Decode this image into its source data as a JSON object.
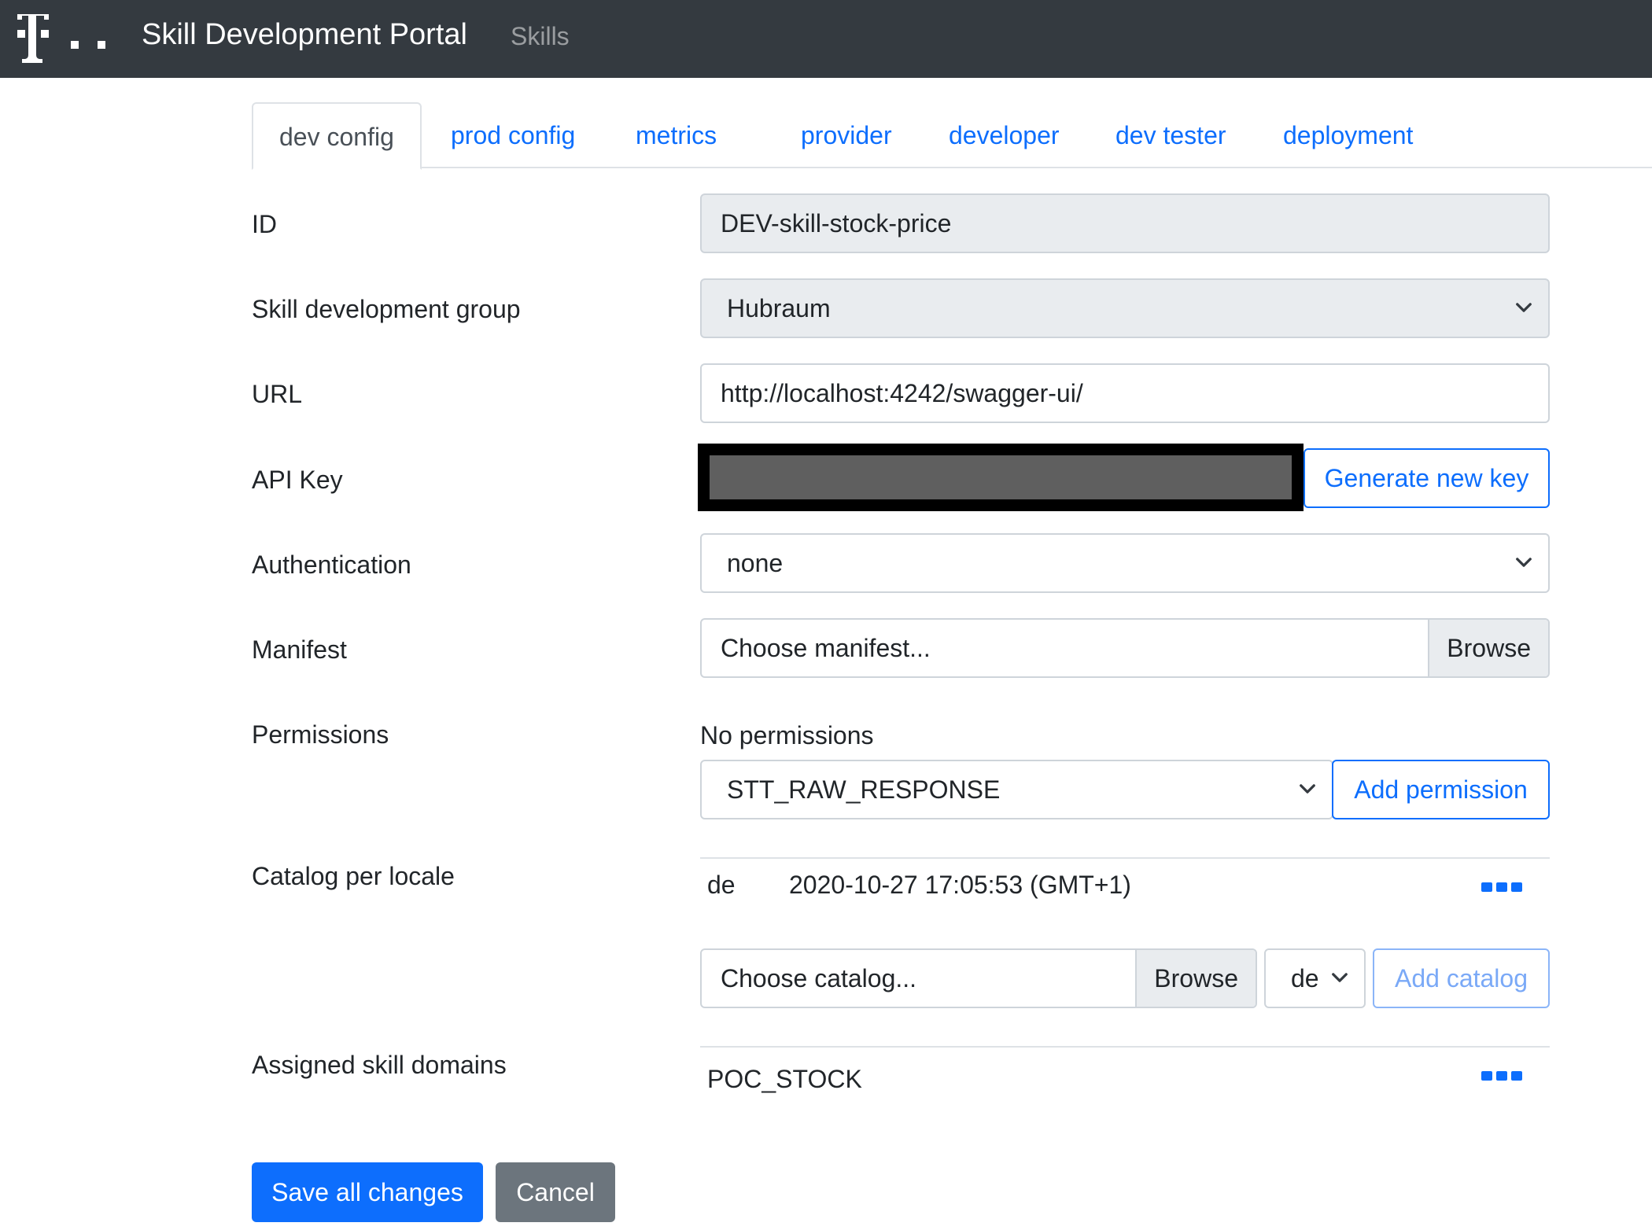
{
  "navbar": {
    "brand": "Skill Development Portal",
    "nav_link": "Skills",
    "logo_icon": "telekom-t-logo"
  },
  "tabs": [
    {
      "label": "dev config",
      "active": true
    },
    {
      "label": "prod config",
      "active": false
    },
    {
      "label": "metrics",
      "active": false
    },
    {
      "label": "provider",
      "active": false
    },
    {
      "label": "developer",
      "active": false
    },
    {
      "label": "dev tester",
      "active": false
    },
    {
      "label": "deployment",
      "active": false
    }
  ],
  "form": {
    "id": {
      "label": "ID",
      "value": "DEV-skill-stock-price"
    },
    "group": {
      "label": "Skill development group",
      "value": "Hubraum"
    },
    "url": {
      "label": "URL",
      "value": "http://localhost:4242/swagger-ui/"
    },
    "api_key": {
      "label": "API Key",
      "button": "Generate new key"
    },
    "authentication": {
      "label": "Authentication",
      "value": "none"
    },
    "manifest": {
      "label": "Manifest",
      "placeholder": "Choose manifest...",
      "browse": "Browse"
    },
    "permissions": {
      "label": "Permissions",
      "status": "No permissions",
      "selected": "STT_RAW_RESPONSE",
      "button": "Add permission"
    },
    "catalog": {
      "label": "Catalog per locale",
      "entries": [
        {
          "locale": "de",
          "timestamp": "2020-10-27 17:05:53 (GMT+1)"
        }
      ],
      "placeholder": "Choose catalog...",
      "browse": "Browse",
      "locale_selected": "de",
      "button": "Add catalog"
    },
    "domains": {
      "label": "Assigned skill domains",
      "entries": [
        "POC_STOCK"
      ]
    }
  },
  "actions": {
    "save": "Save all changes",
    "cancel": "Cancel"
  },
  "colors": {
    "navbar_bg": "#343a40",
    "primary": "#0d6efd",
    "secondary": "#6c757d"
  }
}
